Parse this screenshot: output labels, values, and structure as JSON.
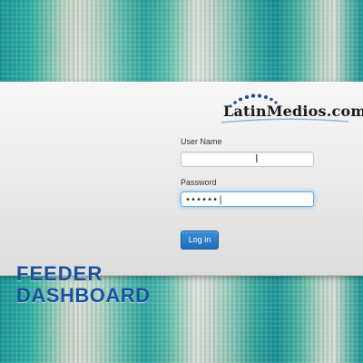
{
  "brand": {
    "logo_text": "LatinMedios.com",
    "logo_trademark": "®",
    "accent_color": "#17529b",
    "logo_arc_color": "#1f4fa0"
  },
  "title": {
    "line1": "FEEDER",
    "line2": "DASHBOARD"
  },
  "form": {
    "username_label": "User Name",
    "username_value": "",
    "password_label": "Password",
    "password_value": "••••••|",
    "login_label": "Log in"
  },
  "icons": {
    "text_cursor": "I"
  }
}
